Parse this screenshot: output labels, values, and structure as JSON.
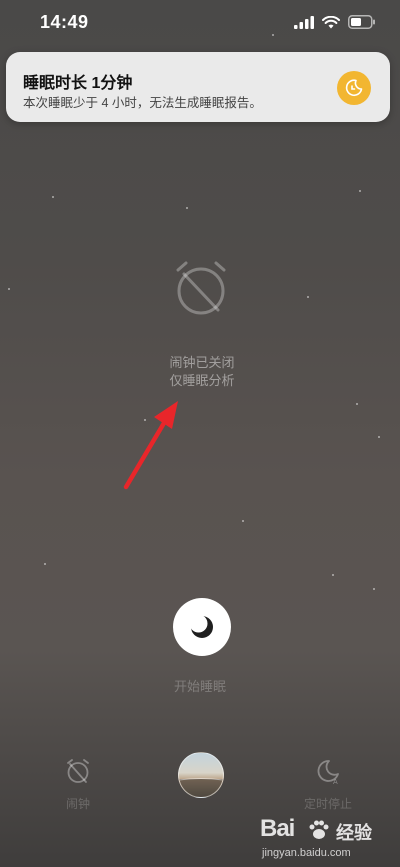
{
  "status_bar": {
    "time": "14:49"
  },
  "notification": {
    "title": "睡眠时长 1分钟",
    "body": "本次睡眠少于 4 小时，无法生成睡眠报告。",
    "icon": "moon-clock-icon",
    "accent_color": "#f2b631"
  },
  "alarm": {
    "status_line1": "闹钟已关闭",
    "status_line2": "仅睡眠分析",
    "icon": "alarm-off-icon"
  },
  "start_sleep": {
    "label": "开始睡眠",
    "icon": "moon-icon"
  },
  "bottom_tabs": [
    {
      "label": "闹钟",
      "icon": "alarm-off-icon"
    },
    {
      "label": "",
      "icon": "scene-thumbnail"
    },
    {
      "label": "定时停止",
      "icon": "moon-timer-icon"
    }
  ],
  "watermark": {
    "logo": "Bai",
    "cn": "经验",
    "url": "jingyan.baidu.com"
  },
  "colors": {
    "annotation_arrow": "#e8262a"
  }
}
